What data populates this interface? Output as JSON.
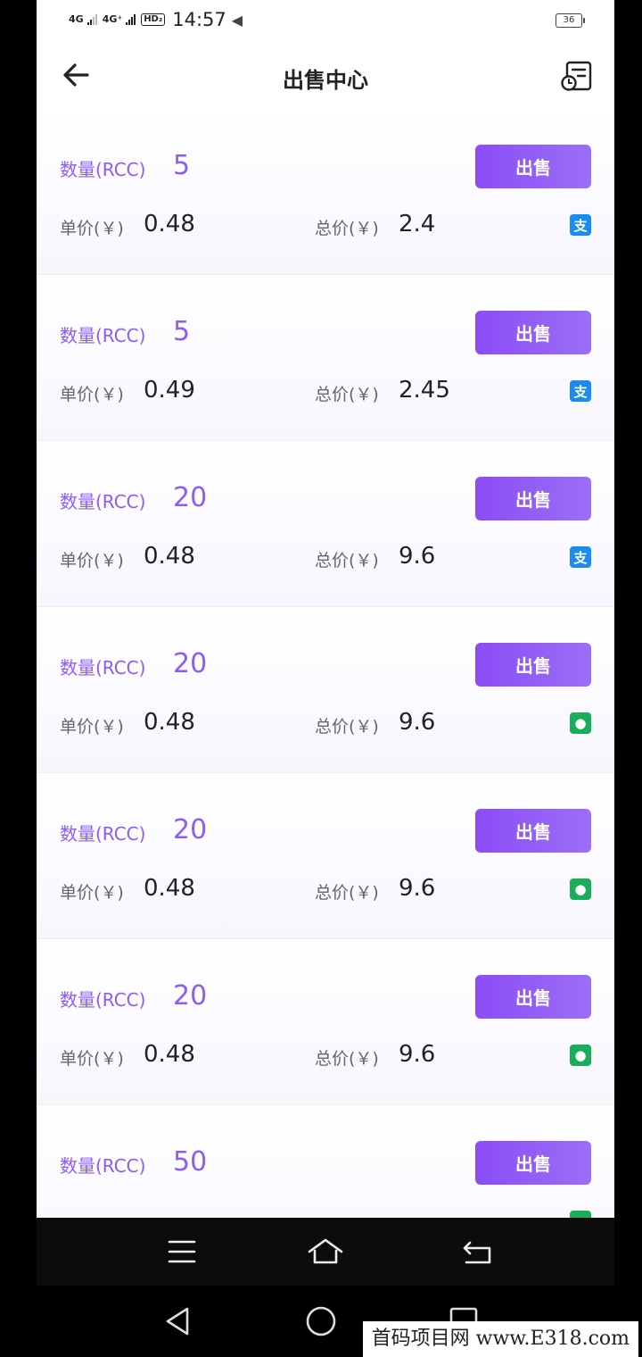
{
  "status_bar": {
    "net1": "4G",
    "net2": "4G⁺",
    "hd": "HD₂",
    "time": "14:57",
    "battery": "36"
  },
  "header": {
    "title": "出售中心",
    "back_icon": "arrow-left-icon",
    "records_icon": "order-record-icon"
  },
  "orders": [
    {
      "qty_label": "数量(RCC)",
      "qty": "5",
      "sell": "出售",
      "unit_label": "单价(￥)",
      "unit_price": "0.48",
      "total_label": "总价(￥)",
      "total": "2.4",
      "pay": "alipay",
      "pay_glyph": "支"
    },
    {
      "qty_label": "数量(RCC)",
      "qty": "5",
      "sell": "出售",
      "unit_label": "单价(￥)",
      "unit_price": "0.49",
      "total_label": "总价(￥)",
      "total": "2.45",
      "pay": "alipay",
      "pay_glyph": "支"
    },
    {
      "qty_label": "数量(RCC)",
      "qty": "20",
      "sell": "出售",
      "unit_label": "单价(￥)",
      "unit_price": "0.48",
      "total_label": "总价(￥)",
      "total": "9.6",
      "pay": "alipay",
      "pay_glyph": "支"
    },
    {
      "qty_label": "数量(RCC)",
      "qty": "20",
      "sell": "出售",
      "unit_label": "单价(￥)",
      "unit_price": "0.48",
      "total_label": "总价(￥)",
      "total": "9.6",
      "pay": "wechat",
      "pay_glyph": "●"
    },
    {
      "qty_label": "数量(RCC)",
      "qty": "20",
      "sell": "出售",
      "unit_label": "单价(￥)",
      "unit_price": "0.48",
      "total_label": "总价(￥)",
      "total": "9.6",
      "pay": "wechat",
      "pay_glyph": "●"
    },
    {
      "qty_label": "数量(RCC)",
      "qty": "20",
      "sell": "出售",
      "unit_label": "单价(￥)",
      "unit_price": "0.48",
      "total_label": "总价(￥)",
      "total": "9.6",
      "pay": "wechat",
      "pay_glyph": "●"
    },
    {
      "qty_label": "数量(RCC)",
      "qty": "50",
      "sell": "出售",
      "unit_label": "",
      "unit_price": "",
      "total_label": "",
      "total": "",
      "pay": "wechat",
      "pay_glyph": ""
    }
  ],
  "nav": {
    "menu_icon": "menu-icon",
    "home_icon": "home-icon",
    "back_icon": "return-icon"
  },
  "system_nav": {
    "back_icon": "triangle-back-icon",
    "home_icon": "circle-home-icon",
    "recents_icon": "square-recents-icon"
  },
  "watermark": "首码项目网 www.E318.com",
  "colors": {
    "accent": "#8b5cf6",
    "alipay": "#1a8cf0",
    "wechat": "#1aad5a"
  }
}
